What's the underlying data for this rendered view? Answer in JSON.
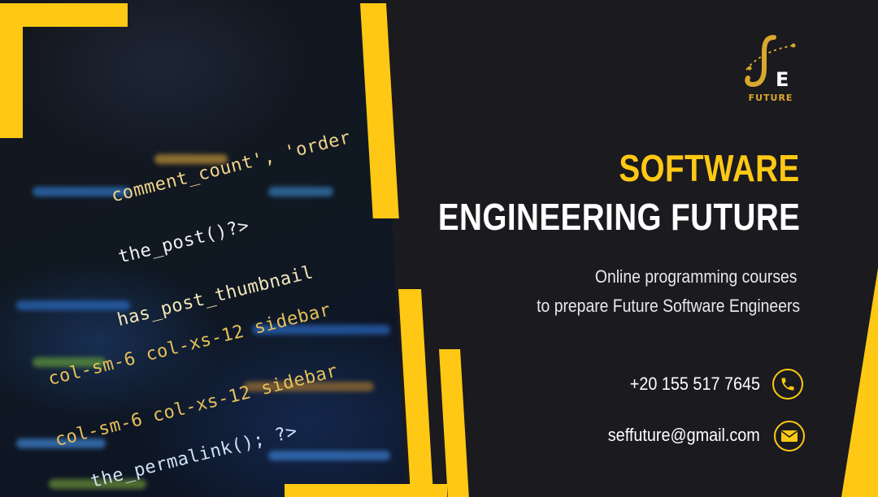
{
  "brand": {
    "logo_letters": "E",
    "logo_text": "FUTURE",
    "colors": {
      "accent": "#ffc814",
      "background": "#1b1a1f",
      "logo_gold": "#d9a82c"
    }
  },
  "headline": {
    "line_1": "SOFTWARE",
    "line_2": "ENGINEERING FUTURE"
  },
  "tagline": {
    "line_1": "Online programming courses",
    "line_2": "to prepare Future Software Engineers"
  },
  "contact": {
    "phone": "+20 155 517 7645",
    "email": "seffuture@gmail.com",
    "phone_icon": "phone-icon",
    "email_icon": "envelope-icon"
  },
  "code_snippet": {
    "lines": [
      "comment_count', 'order",
      "the_post()?>",
      "has_post_thumbnail",
      "col-sm-6 col-xs-12 sidebar",
      "col-sm-6 col-xs-12 sidebar",
      "the_permalink(); ?>"
    ]
  }
}
